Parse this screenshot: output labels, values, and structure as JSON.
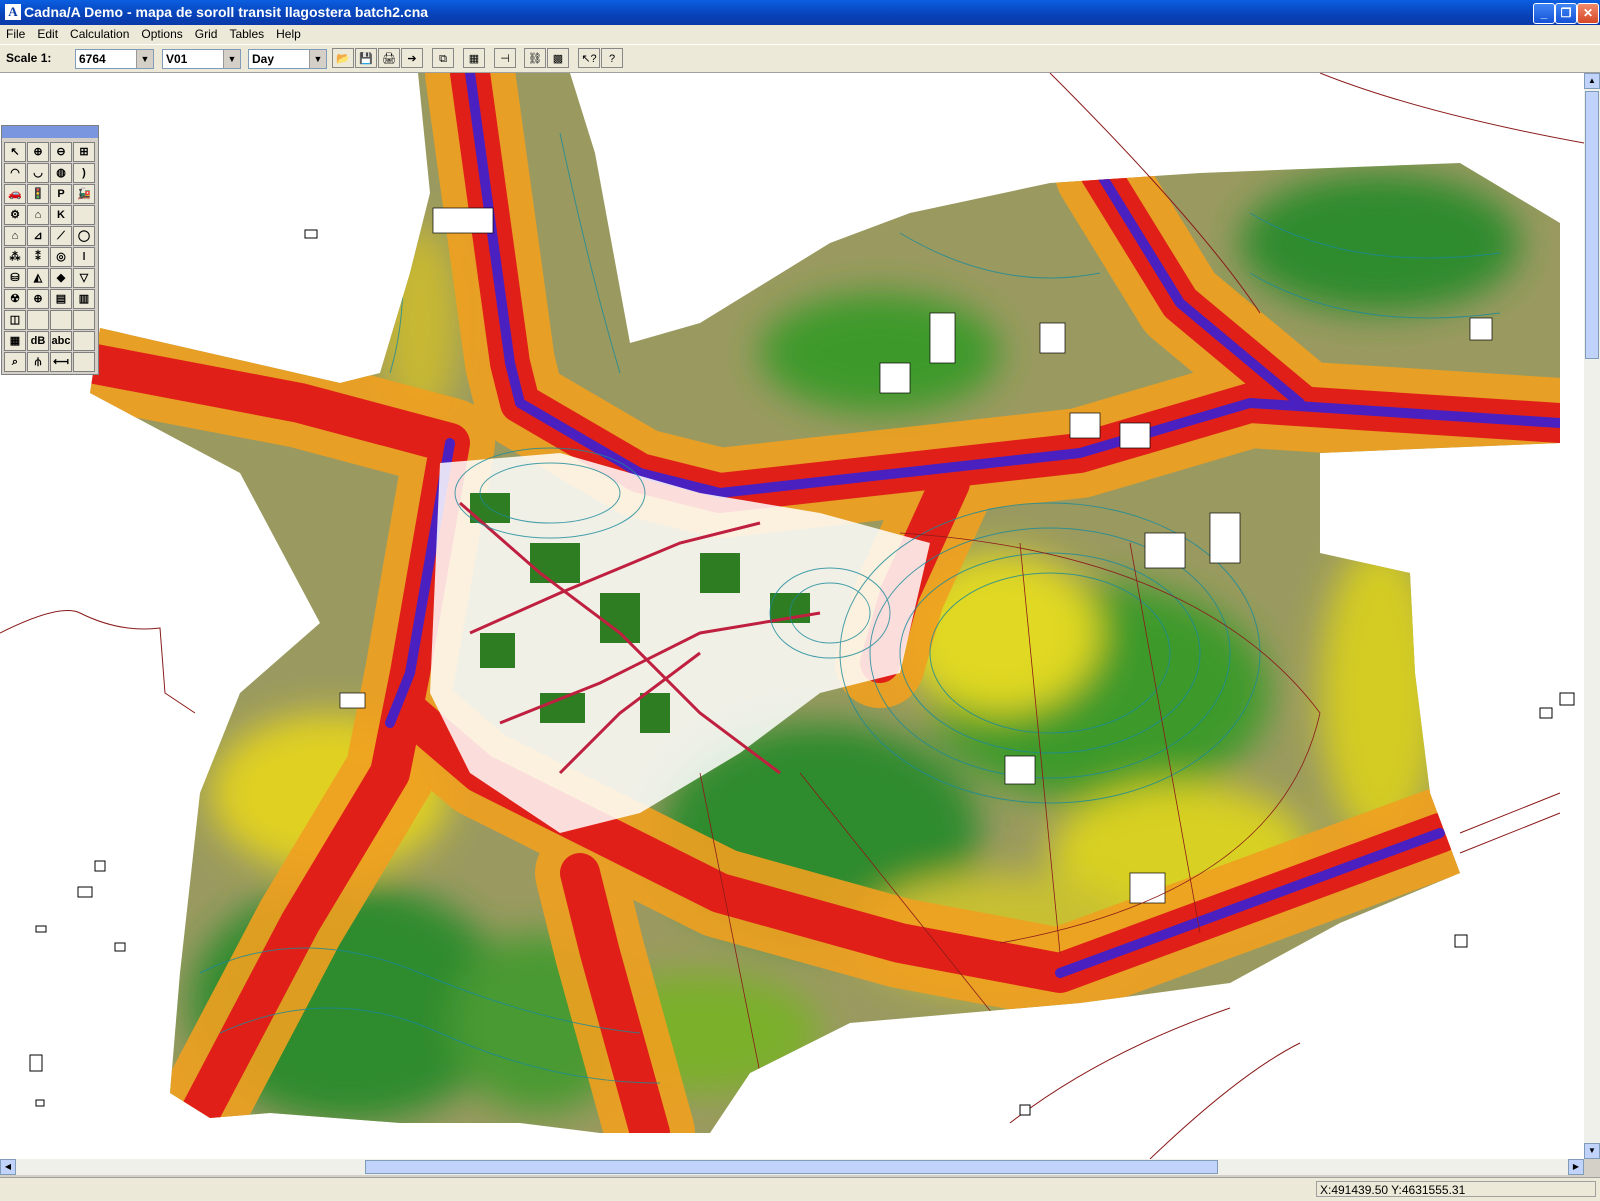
{
  "window": {
    "app_icon": "A",
    "title": "Cadna/A Demo - mapa de soroll transit llagostera batch2.cna",
    "minimize": "_",
    "restore": "❐",
    "close": "✕"
  },
  "menu": [
    "File",
    "Edit",
    "Calculation",
    "Options",
    "Grid",
    "Tables",
    "Help"
  ],
  "toolbar": {
    "scale_label": "Scale 1:",
    "scale_value": "6764",
    "variant_value": "V01",
    "period_value": "Day",
    "icons": [
      "open-icon",
      "save-icon",
      "print-icon",
      "export-icon",
      "copy-icon",
      "calculator-icon",
      "pin-icon",
      "link-icon",
      "grid-calc-icon",
      "context-help-icon",
      "help-icon"
    ],
    "icon_glyphs": [
      "📂",
      "💾",
      "🖨",
      "➔",
      "⧉",
      "▦",
      "⊣",
      "⛓",
      "▩",
      "↖?",
      "?"
    ]
  },
  "palette": {
    "tools": [
      {
        "name": "pointer-icon",
        "glyph": "↖"
      },
      {
        "name": "zoom-in-icon",
        "glyph": "⊕"
      },
      {
        "name": "zoom-out-icon",
        "glyph": "⊖"
      },
      {
        "name": "zoom-window-icon",
        "glyph": "⊞"
      },
      {
        "name": "point-source-icon",
        "glyph": "◠"
      },
      {
        "name": "line-source-icon",
        "glyph": "◡"
      },
      {
        "name": "area-source-icon",
        "glyph": "◍"
      },
      {
        "name": "vertical-source-icon",
        "glyph": ")"
      },
      {
        "name": "road-icon",
        "glyph": "🚗"
      },
      {
        "name": "traffic-light-icon",
        "glyph": "🚦"
      },
      {
        "name": "parking-icon",
        "glyph": "P"
      },
      {
        "name": "railway-icon",
        "glyph": "🚂"
      },
      {
        "name": "industry-icon",
        "glyph": "⚙"
      },
      {
        "name": "building-hall-icon",
        "glyph": "⌂"
      },
      {
        "name": "k-icon",
        "glyph": "K"
      },
      {
        "name": "empty-slot-icon",
        "glyph": ""
      },
      {
        "name": "building-icon",
        "glyph": "⌂"
      },
      {
        "name": "barrier-icon",
        "glyph": "⊿"
      },
      {
        "name": "embankment-icon",
        "glyph": "⟋"
      },
      {
        "name": "cylinder-icon",
        "glyph": "◯"
      },
      {
        "name": "trees-icon",
        "glyph": "⁂"
      },
      {
        "name": "forest-icon",
        "glyph": "⁑"
      },
      {
        "name": "contour-icon",
        "glyph": "◎"
      },
      {
        "name": "height-point-icon",
        "glyph": "ǀ"
      },
      {
        "name": "tank-icon",
        "glyph": "⛁"
      },
      {
        "name": "terrain-icon",
        "glyph": "◭"
      },
      {
        "name": "ground-area-icon",
        "glyph": "◆"
      },
      {
        "name": "dropdown-icon",
        "glyph": "▽"
      },
      {
        "name": "radiation-icon",
        "glyph": "☢"
      },
      {
        "name": "globe-icon",
        "glyph": "⊕"
      },
      {
        "name": "bitmap-icon",
        "glyph": "▤"
      },
      {
        "name": "table-icon",
        "glyph": "▥"
      },
      {
        "name": "receiver-area-icon",
        "glyph": "◫"
      },
      {
        "name": "empty-slot-icon-2",
        "glyph": ""
      },
      {
        "name": "empty-slot-icon-3",
        "glyph": ""
      },
      {
        "name": "empty-slot-icon-4",
        "glyph": ""
      },
      {
        "name": "grid-icon",
        "glyph": "▦"
      },
      {
        "name": "db-icon",
        "glyph": "dB"
      },
      {
        "name": "text-icon",
        "glyph": "abc"
      },
      {
        "name": "empty-slot-icon-5",
        "glyph": ""
      },
      {
        "name": "measure-icon",
        "glyph": "⌕"
      },
      {
        "name": "section-icon",
        "glyph": "⫛"
      },
      {
        "name": "distance-icon",
        "glyph": "⟻"
      },
      {
        "name": "empty-slot-icon-6",
        "glyph": ""
      }
    ]
  },
  "scrollbars": {
    "up": "▲",
    "down": "▼",
    "left": "◀",
    "right": "▶"
  },
  "status": {
    "coordinates": "X:491439.50 Y:4631555.31"
  },
  "colors": {
    "green": "#2e8b2e",
    "yellow": "#e8e020",
    "orange": "#f0a020",
    "red": "#e02018",
    "blue": "#2020d0",
    "contour": "#1a8a9a"
  }
}
